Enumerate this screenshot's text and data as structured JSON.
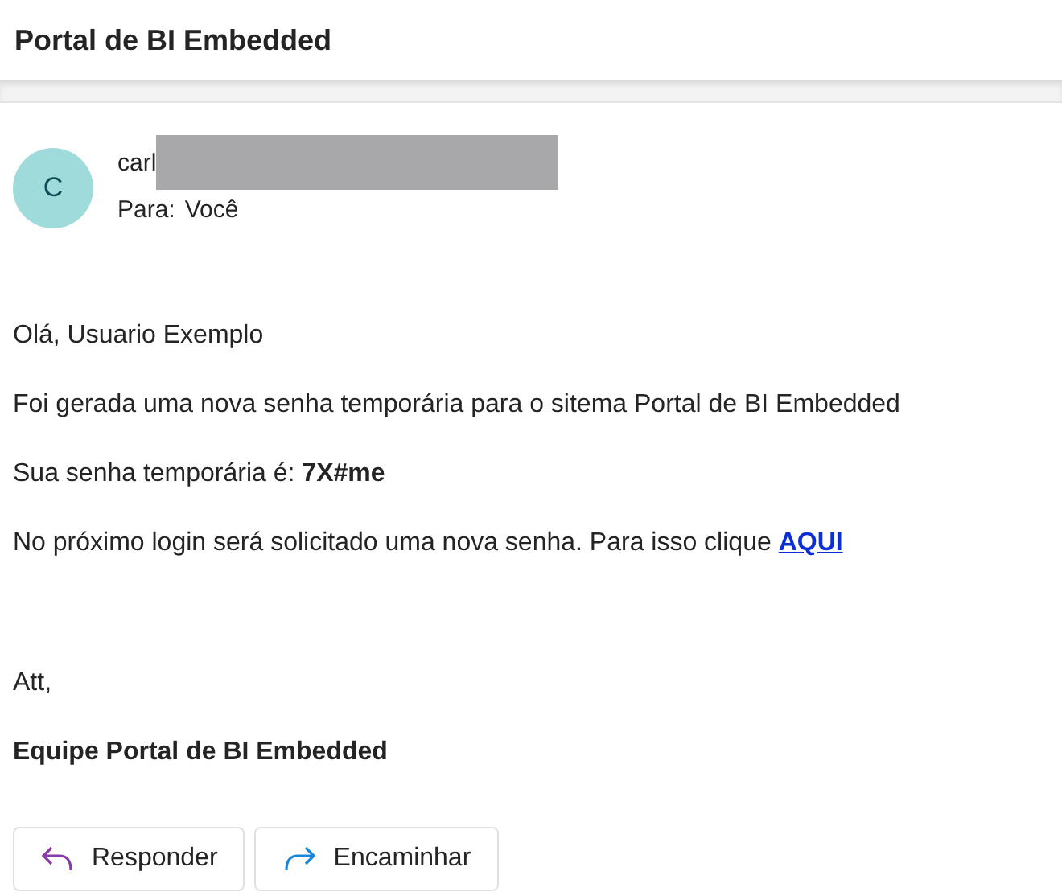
{
  "header": {
    "title": "Portal de BI Embedded"
  },
  "message": {
    "avatar_initial": "C",
    "sender": "carl",
    "recipient_label": "Para:",
    "recipient": "Você"
  },
  "body": [
    {
      "kind": "text",
      "text": "Olá, Usuario Exemplo"
    },
    {
      "kind": "text",
      "text": "Foi gerada uma nova senha temporária para o sitema Portal de BI Embedded"
    },
    {
      "kind": "text",
      "text": "Sua senha temporária é: **7X#me**"
    },
    {
      "kind": "link_line",
      "text": "No próximo login será solicitado uma nova senha. Para isso clique",
      "link": "AQUI"
    }
  ],
  "signature": [
    {
      "kind": "text",
      "text": "Att,"
    },
    {
      "kind": "bold",
      "text": "Equipe Portal de BI Embedded"
    }
  ],
  "actions": [
    {
      "kind": "reply",
      "label": "Responder"
    },
    {
      "kind": "forward",
      "label": "Encaminhar"
    }
  ]
}
